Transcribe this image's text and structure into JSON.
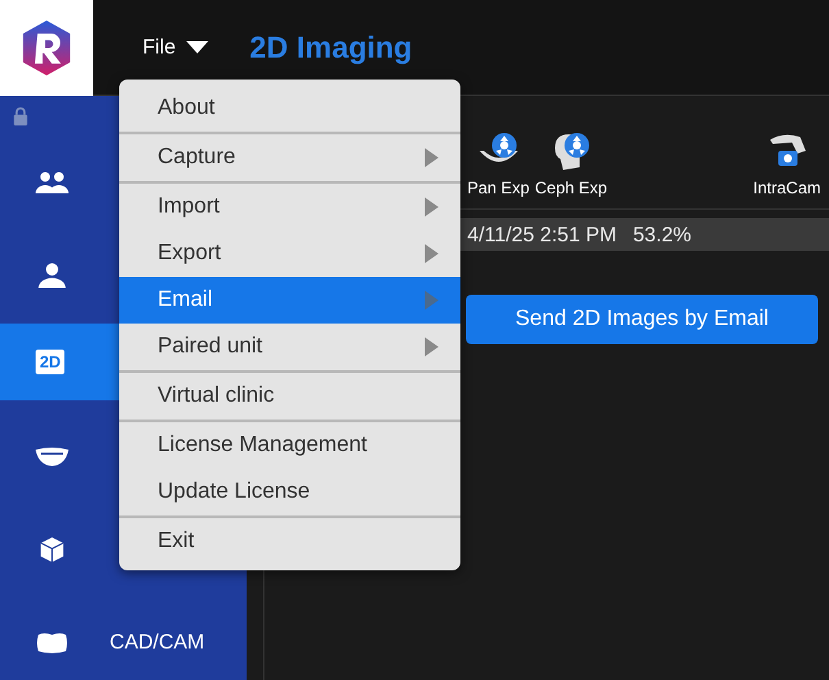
{
  "app_title": "2D Imaging",
  "menu_button": {
    "label": "File"
  },
  "sidebar": {
    "items": [
      {
        "kind": "patients",
        "selected": false
      },
      {
        "kind": "file",
        "selected": false
      },
      {
        "kind": "flat",
        "icon_text": "2D",
        "selected": true
      },
      {
        "kind": "smile",
        "selected": false
      },
      {
        "kind": "cube",
        "selected": false
      },
      {
        "kind": "cadcam",
        "label": "CAD/CAM",
        "selected": false
      }
    ]
  },
  "toolbar": [
    {
      "kind": "pan",
      "label": "Pan Exp"
    },
    {
      "kind": "ceph",
      "label": "Ceph Exp"
    },
    {
      "kind": "intracam",
      "label": "IntraCam"
    }
  ],
  "status": {
    "timestamp": "4/11/25 2:51 PM",
    "percent": "53.2%"
  },
  "file_menu": {
    "items": [
      {
        "label": "About",
        "submenu": false,
        "selected": false,
        "separator_after": true
      },
      {
        "label": "Capture",
        "submenu": true,
        "selected": false,
        "separator_after": true
      },
      {
        "label": "Import",
        "submenu": true,
        "selected": false,
        "separator_after": false
      },
      {
        "label": "Export",
        "submenu": true,
        "selected": false,
        "separator_after": false
      },
      {
        "label": "Email",
        "submenu": true,
        "selected": true,
        "separator_after": false
      },
      {
        "label": "Paired unit",
        "submenu": true,
        "selected": false,
        "separator_after": true
      },
      {
        "label": "Virtual clinic",
        "submenu": false,
        "selected": false,
        "separator_after": true
      },
      {
        "label": "License Management",
        "submenu": false,
        "selected": false,
        "separator_after": false
      },
      {
        "label": "Update License",
        "submenu": false,
        "selected": false,
        "separator_after": true
      },
      {
        "label": "Exit",
        "submenu": false,
        "selected": false,
        "separator_after": false
      }
    ]
  },
  "submenu": {
    "items": [
      {
        "label": "Send 2D Images by Email",
        "selected": true
      }
    ]
  }
}
